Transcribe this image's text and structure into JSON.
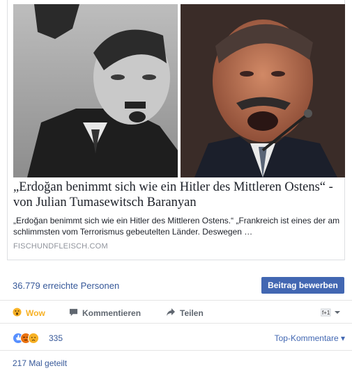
{
  "link_preview": {
    "headline": "„Erdoğan benimmt sich wie ein Hitler des Mittleren Ostens“ - von Julian Tumasewitsch Baranyan",
    "description": "„Erdoğan benimmt sich wie ein Hitler des Mittleren Ostens.“ „Frankreich ist eines der am schlimmsten vom Terrorismus gebeutelten Länder. Deswegen …",
    "domain": "FISCHUNDFLEISCH.COM",
    "left_image": "portrait-left",
    "right_image": "portrait-right"
  },
  "reach": {
    "text": "36.779 erreichte Personen",
    "promote_label": "Beitrag bewerben",
    "promote_color": "#4267b2"
  },
  "actions": {
    "wow_label": "Wow",
    "comment_label": "Kommentieren",
    "share_label": "Teilen"
  },
  "reactions": {
    "count": "335",
    "icons": [
      "like-icon",
      "angry-icon",
      "sad-icon"
    ],
    "sort_label": "Top-Kommentare ▾"
  },
  "shares": {
    "text": "217 Mal geteilt"
  }
}
